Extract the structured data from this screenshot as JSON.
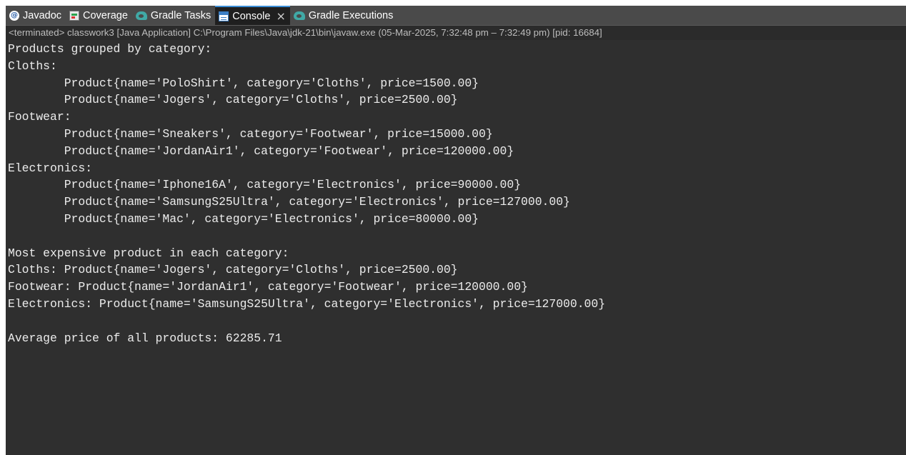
{
  "tabs": [
    {
      "label": "Javadoc",
      "icon": "javadoc-icon",
      "active": false
    },
    {
      "label": "Coverage",
      "icon": "coverage-icon",
      "active": false
    },
    {
      "label": "Gradle Tasks",
      "icon": "gradle-icon",
      "active": false
    },
    {
      "label": "Console",
      "icon": "console-icon",
      "active": true
    },
    {
      "label": "Gradle Executions",
      "icon": "gradle-icon",
      "active": false
    }
  ],
  "close_glyph": "×",
  "status": "<terminated> classwork3 [Java Application] C:\\Program Files\\Java\\jdk-21\\bin\\javaw.exe  (05-Mar-2025, 7:32:48 pm – 7:32:49 pm) [pid: 16684]",
  "console_lines": [
    "Products grouped by category:",
    "Cloths:",
    "        Product{name='PoloShirt', category='Cloths', price=1500.00}",
    "        Product{name='Jogers', category='Cloths', price=2500.00}",
    "Footwear:",
    "        Product{name='Sneakers', category='Footwear', price=15000.00}",
    "        Product{name='JordanAir1', category='Footwear', price=120000.00}",
    "Electronics:",
    "        Product{name='Iphone16A', category='Electronics', price=90000.00}",
    "        Product{name='SamsungS25Ultra', category='Electronics', price=127000.00}",
    "        Product{name='Mac', category='Electronics', price=80000.00}",
    "",
    "Most expensive product in each category:",
    "Cloths: Product{name='Jogers', category='Cloths', price=2500.00}",
    "Footwear: Product{name='JordanAir1', category='Footwear', price=120000.00}",
    "Electronics: Product{name='SamsungS25Ultra', category='Electronics', price=127000.00}",
    "",
    "Average price of all products: 62285.71"
  ],
  "colors": {
    "panel_bg": "#2f2f2f",
    "tabbar_bg": "#4a4a4a",
    "active_tab_bg": "#1f1f1f",
    "console_text": "#ececec",
    "status_text": "#bdbdbd",
    "gradle_icon": "#40a9a6",
    "console_icon": "#3c7fc4"
  }
}
